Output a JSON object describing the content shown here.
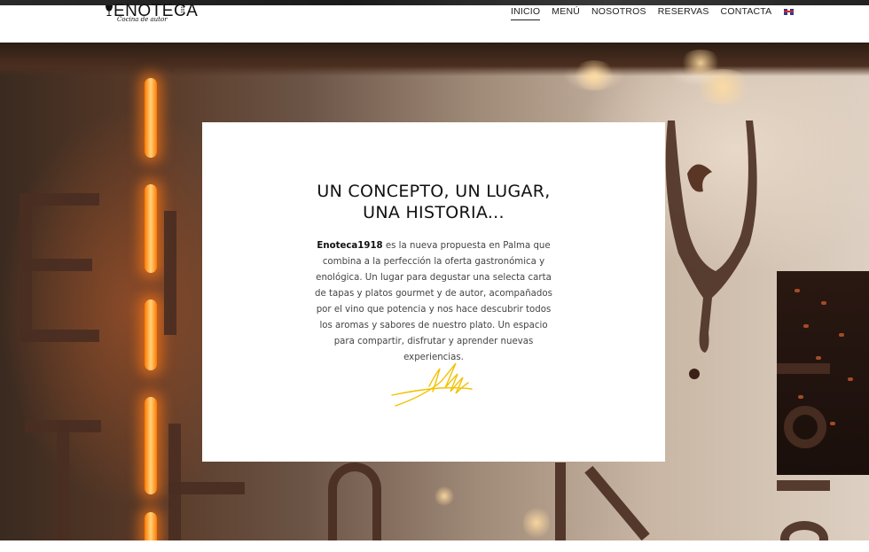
{
  "header": {
    "logo": {
      "name": "ENOTECA",
      "year": "1918",
      "tagline": "Cocina de autor"
    },
    "nav": [
      {
        "label": "INICIO",
        "active": true
      },
      {
        "label": "MENÚ",
        "active": false
      },
      {
        "label": "NOSOTROS",
        "active": false
      },
      {
        "label": "RESERVAS",
        "active": false
      },
      {
        "label": "CONTACTA",
        "active": false
      }
    ],
    "language_flag": "uk-flag-icon"
  },
  "card": {
    "title_line1": "UN CONCEPTO, UN LUGAR,",
    "title_line2": "UNA HISTORIA...",
    "body_bold": "Enoteca1918",
    "body_text": " es la nueva propuesta en Palma que combina a la perfección la oferta gastronómica y enológica. Un lugar para degustar una selecta carta de tapas y platos gourmet y de autor, acompañados por el vino que potencia y nos hace descubrir todos los aromas y sabores de nuestro plato. Un espacio para compartir, disfrutar y aprender nuevas experiencias.",
    "signature_color": "#f2c200"
  },
  "colors": {
    "accent": "#f2c200",
    "text_dark": "#111111",
    "text_body": "#444444"
  }
}
